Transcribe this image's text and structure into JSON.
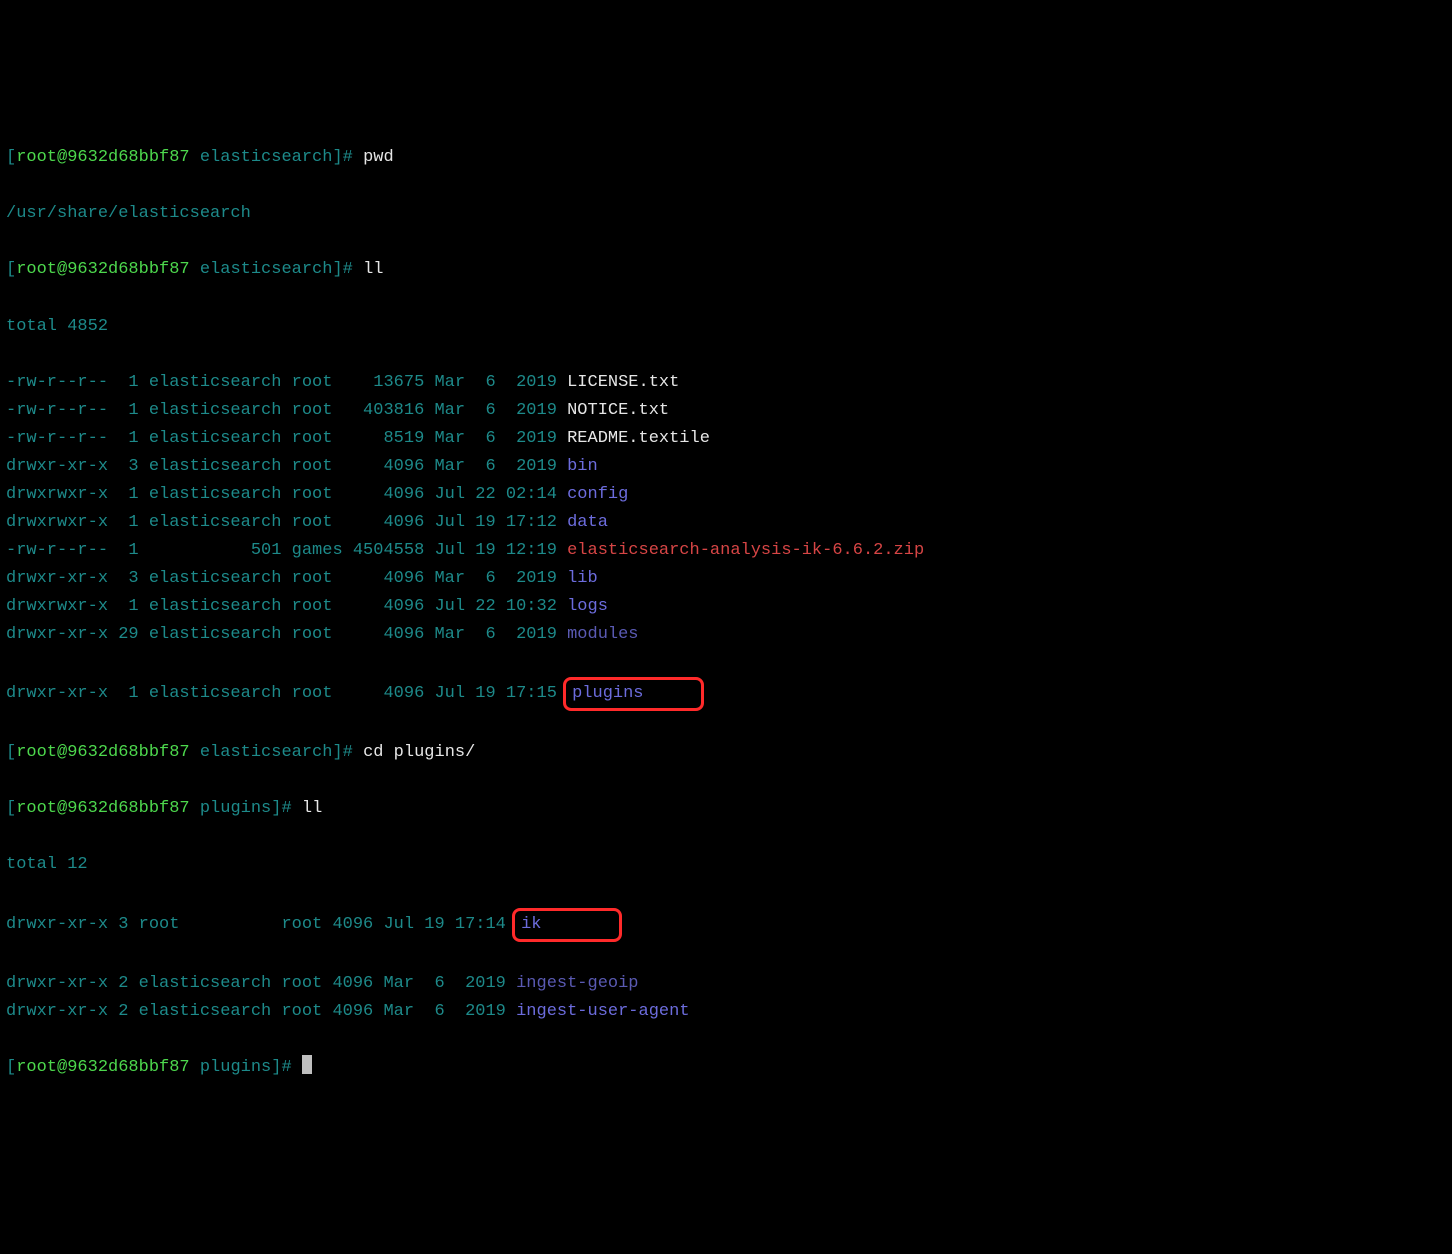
{
  "prompt1": {
    "open": "[",
    "user_host": "root@9632d68bbf87",
    "dir": " elasticsearch",
    "close": "]# ",
    "cmd_pwd": "pwd",
    "cmd_ll": "ll",
    "cmd_cd": "cd plugins/"
  },
  "pwd_out": "/usr/share/elasticsearch",
  "total1": "total 4852",
  "rows1": [
    {
      "perm": "-rw-r--r--  1 elasticsearch root    13675 Mar  6  2019 ",
      "name": "LICENSE.txt",
      "cls": "white"
    },
    {
      "perm": "-rw-r--r--  1 elasticsearch root   403816 Mar  6  2019 ",
      "name": "NOTICE.txt",
      "cls": "white"
    },
    {
      "perm": "-rw-r--r--  1 elasticsearch root     8519 Mar  6  2019 ",
      "name": "README.textile",
      "cls": "white"
    },
    {
      "perm": "drwxr-xr-x  3 elasticsearch root     4096 Mar  6  2019 ",
      "name": "bin",
      "cls": "blue"
    },
    {
      "perm": "drwxrwxr-x  1 elasticsearch root     4096 Jul 22 02:14 ",
      "name": "config",
      "cls": "blue"
    },
    {
      "perm": "drwxrwxr-x  1 elasticsearch root     4096 Jul 19 17:12 ",
      "name": "data",
      "cls": "blue"
    },
    {
      "perm": "-rw-r--r--  1           501 games 4504558 Jul 19 12:19 ",
      "name": "elasticsearch-analysis-ik-6.6.2.zip",
      "cls": "red"
    },
    {
      "perm": "drwxr-xr-x  3 elasticsearch root     4096 Mar  6  2019 ",
      "name": "lib",
      "cls": "blue"
    },
    {
      "perm": "drwxrwxr-x  1 elasticsearch root     4096 Jul 22 10:32 ",
      "name": "logs",
      "cls": "blue"
    },
    {
      "perm": "drwxr-xr-x 29 elasticsearch root     4096 Mar  6  2019 ",
      "name": "modules",
      "cls": "dimpurple"
    }
  ],
  "row_plugins": {
    "perm": "drwxr-xr-x  1 elasticsearch root     4096 Jul 19 17:15 ",
    "name": "plugins"
  },
  "prompt2": {
    "open": "[",
    "user_host": "root@9632d68bbf87",
    "dir": " plugins",
    "close": "]# ",
    "cmd_ll": "ll"
  },
  "total2": "total 12",
  "row_ik": {
    "perm": "drwxr-xr-x 3 root          root 4096 Jul 19 17:14 ",
    "name": "ik"
  },
  "rows2": [
    {
      "perm": "drwxr-xr-x 2 elasticsearch root 4096 Mar  6  2019 ",
      "name": "ingest-geoip",
      "cls": "dimpurple"
    },
    {
      "perm": "drwxr-xr-x 2 elasticsearch root 4096 Mar  6  2019 ",
      "name": "ingest-user-agent",
      "cls": "blue"
    }
  ]
}
